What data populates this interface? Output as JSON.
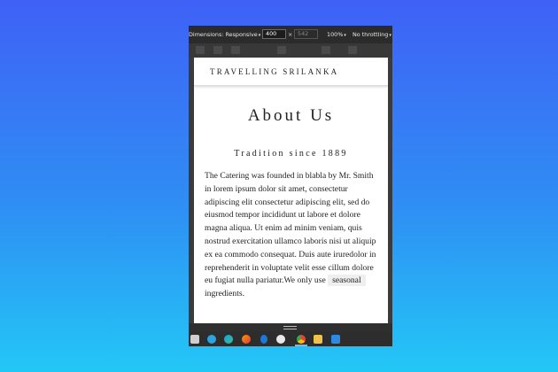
{
  "devtools": {
    "dimensions_label": "Dimensions: Responsive",
    "width_value": "400",
    "times_sign": "×",
    "height_placeholder": "542",
    "zoom_label": "100%",
    "throttling_label": "No throttling",
    "caret": "▾"
  },
  "site": {
    "brand": "TRAVELLING SRILANKA",
    "title": "About Us",
    "subtitle": "Tradition since 1889",
    "body_text": "The Catering was founded in blabla by Mr. Smith in lorem ipsum dolor sit amet, consectetur adipiscing elit consectetur adipiscing elit, sed do eiusmod tempor incididunt ut labore et dolore magna aliqua. Ut enim ad minim veniam, quis nostrud exercitation ullamco laboris nisi ut aliquip ex ea commodo consequat. Duis aute iruredolor in reprehenderit in voluptate velit esse cillum dolore eu fugiat nulla pariatur.We only use",
    "highlight": "seasonal",
    "body_end": "ingredients."
  },
  "taskbar": {
    "icons": [
      "app-icon",
      "telegram-icon",
      "edge-icon",
      "firefox-icon",
      "bluetooth-icon",
      "photos-icon",
      "chrome-icon",
      "file-explorer-icon",
      "vscode-icon"
    ],
    "active": "chrome-icon"
  },
  "colors": {
    "background_top": "#3f61f6",
    "background_bottom": "#23c7f6",
    "devtools_dark": "#2b2b2b"
  }
}
